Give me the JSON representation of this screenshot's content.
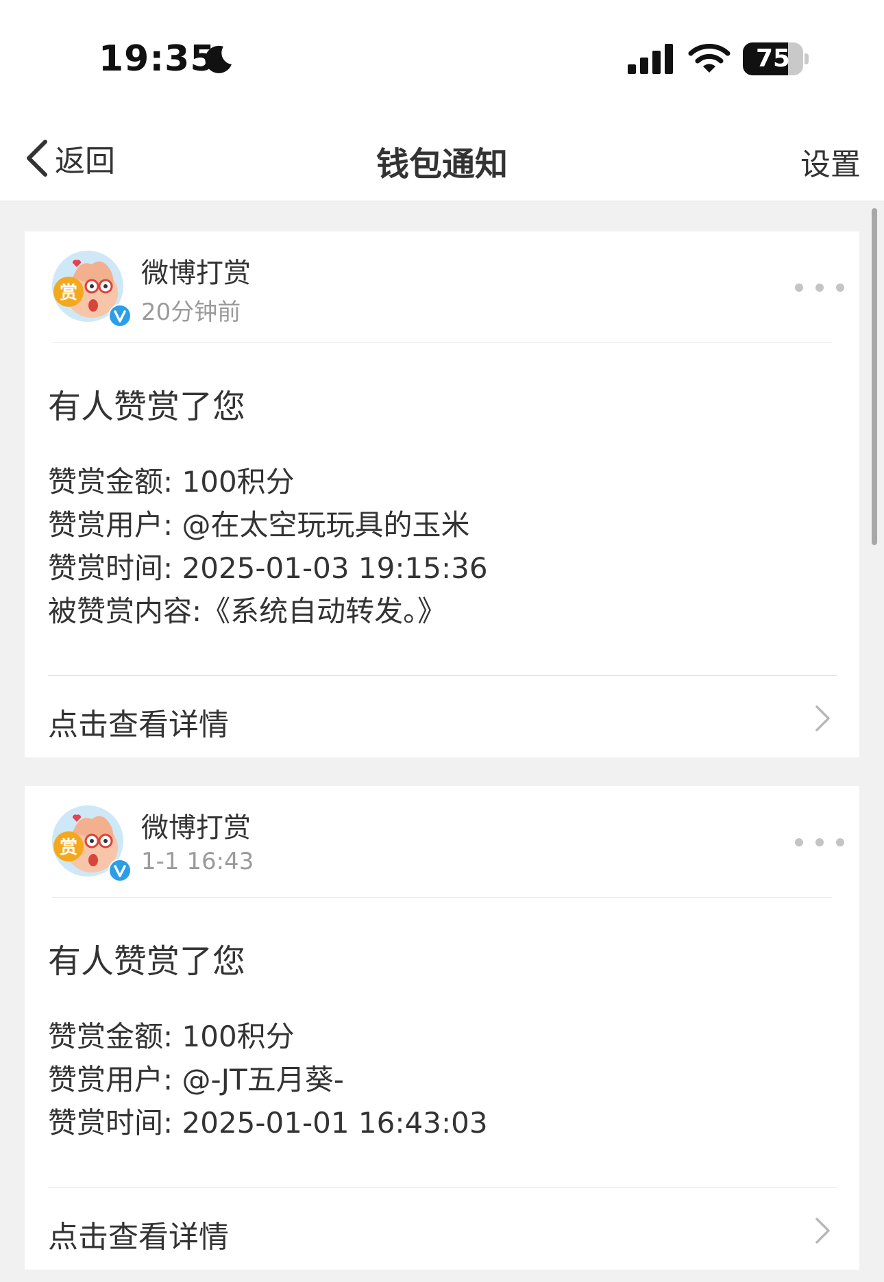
{
  "status_bar": {
    "time": "19:35",
    "battery": "75",
    "battery_level": 0.75,
    "icons": [
      "moon-icon",
      "signal-icon",
      "wifi-icon",
      "battery-icon"
    ]
  },
  "nav": {
    "back_label": "返回",
    "title": "钱包通知",
    "settings_label": "设置"
  },
  "notifications": [
    {
      "sender": "微博打赏",
      "time": "20分钟前",
      "title": "有人赞赏了您",
      "lines": [
        "赞赏金额: 100积分",
        "赞赏用户: @在太空玩玩具的玉米",
        "赞赏时间: 2025-01-03 19:15:36",
        "被赞赏内容:《系统自动转发。》"
      ],
      "detail_label": "点击查看详情"
    },
    {
      "sender": "微博打赏",
      "time": "1-1 16:43",
      "title": "有人赞赏了您",
      "lines": [
        "赞赏金额: 100积分",
        "赞赏用户: @-JT五月葵-",
        "赞赏时间: 2025-01-01 16:43:03"
      ],
      "detail_label": "点击查看详情"
    }
  ],
  "colors": {
    "background": "#f1f1f1",
    "card": "#ffffff",
    "text": "#333333",
    "secondary_text": "#9a9a9a",
    "verified_badge": "#2b9ee8",
    "avatar_reward": "#f4a81d"
  }
}
